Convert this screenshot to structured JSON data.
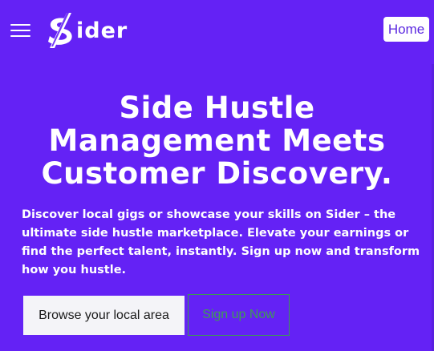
{
  "header": {
    "menu_icon": "hamburger-menu-icon",
    "logo_text": "ider",
    "logo_icon": "sider-s-logo-icon",
    "home_label": "Home"
  },
  "hero": {
    "title_lines": [
      "Side Hustle",
      "Management Meets",
      "Customer Discovery."
    ],
    "description": "Discover local gigs or showcase your skills on Sider – the ultimate side hustle marketplace. Elevate your earnings or find the perfect talent, instantly. Sign up now and transform how you hustle.",
    "browse_label": "Browse your local area",
    "signup_label": "Sign up Now"
  },
  "colors": {
    "background": "#6422f5",
    "home_text": "#5b28e0",
    "signup_accent": "#3b9b52"
  }
}
